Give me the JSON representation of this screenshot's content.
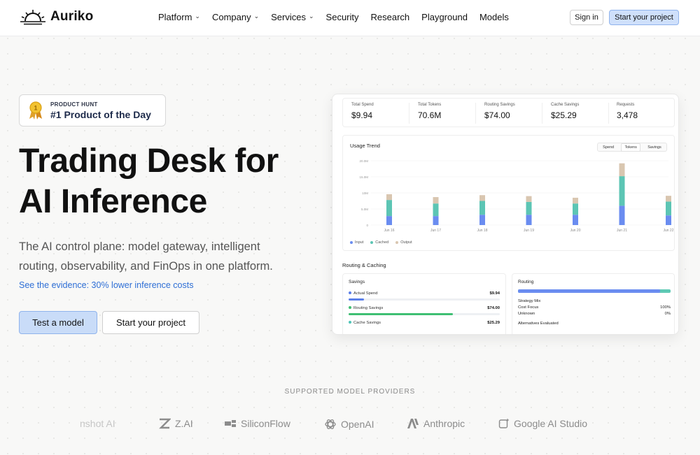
{
  "nav": {
    "brand": "Auriko",
    "links": [
      {
        "label": "Platform",
        "dropdown": true
      },
      {
        "label": "Company",
        "dropdown": true
      },
      {
        "label": "Services",
        "dropdown": true
      },
      {
        "label": "Security",
        "dropdown": false
      },
      {
        "label": "Research",
        "dropdown": false
      },
      {
        "label": "Playground",
        "dropdown": false
      },
      {
        "label": "Models",
        "dropdown": false
      }
    ],
    "sign_in": "Sign in",
    "cta": "Start your project"
  },
  "hero": {
    "badge_small": "PRODUCT HUNT",
    "badge_big": "#1 Product of the Day",
    "title_line1": "Trading Desk for",
    "title_line2": "AI Inference",
    "subtitle": "The AI control plane: model gateway, intelligent routing, observability, and FinOps in one platform.",
    "evidence": "See the evidence: 30% lower inference costs",
    "btn_primary": "Test a model",
    "btn_secondary": "Start your project"
  },
  "dashboard": {
    "stats": [
      {
        "label": "Total Spend",
        "value": "$9.94"
      },
      {
        "label": "Total Tokens",
        "value": "70.6M"
      },
      {
        "label": "Routing Savings",
        "value": "$74.00"
      },
      {
        "label": "Cache Savings",
        "value": "$25.29"
      },
      {
        "label": "Requests",
        "value": "3,478"
      }
    ],
    "usage": {
      "title": "Usage Trend",
      "tabs": [
        "Spend",
        "Tokens",
        "Savings"
      ],
      "active_tab": "Tokens"
    },
    "routing_caching_title": "Routing & Caching",
    "savings": {
      "title": "Savings",
      "rows": [
        {
          "label": "Actual Spend",
          "value": "$9.94",
          "fill": 0.1,
          "color": "#5b7fe9"
        },
        {
          "label": "Routing Savings",
          "value": "$74.00",
          "fill": 0.69,
          "color": "#3fbf73"
        },
        {
          "label": "Cache Savings",
          "value": "$25.29",
          "fill": 0.24,
          "color": "#4fc4b8"
        }
      ]
    },
    "routing": {
      "title": "Routing",
      "strategy_mix": "Strategy Mix",
      "rows": [
        {
          "label": "Cost Focus",
          "value": "100%"
        },
        {
          "label": "Unknown",
          "value": "0%"
        }
      ],
      "alternatives": "Alternatives Evaluated",
      "bar_fill": 0.93
    }
  },
  "chart_data": {
    "type": "bar",
    "stacked": true,
    "title": "Usage Trend",
    "categories": [
      "Jun 16",
      "Jun 17",
      "Jun 18",
      "Jun 19",
      "Jun 20",
      "Jun 21",
      "Jun 22"
    ],
    "y_tick_labels": [
      "0",
      "5.0M",
      "10M",
      "15.0M",
      "20.0M"
    ],
    "ylim": [
      0,
      20000000
    ],
    "series": [
      {
        "name": "Input",
        "color": "#6a8cf0",
        "values": [
          2800000,
          2800000,
          3200000,
          3200000,
          3200000,
          6000000,
          3000000
        ]
      },
      {
        "name": "Cached",
        "color": "#5cc5b4",
        "values": [
          5000000,
          3900000,
          4300000,
          4000000,
          3500000,
          9200000,
          4300000
        ]
      },
      {
        "name": "Output",
        "color": "#d9c6b0",
        "values": [
          1800000,
          2000000,
          1800000,
          1800000,
          1800000,
          4000000,
          1800000
        ]
      }
    ],
    "grid": true,
    "legend": "bottom-left"
  },
  "providers": {
    "title": "SUPPORTED MODEL PROVIDERS",
    "items": [
      {
        "name": "nshot AI",
        "icon": "none"
      },
      {
        "name": "Z.AI",
        "icon": "zai-logo-icon"
      },
      {
        "name": "SiliconFlow",
        "icon": "siliconflow-logo-icon"
      },
      {
        "name": "OpenAI",
        "icon": "openai-logo-icon"
      },
      {
        "name": "Anthropic",
        "icon": "anthropic-logo-icon"
      },
      {
        "name": "Google AI Studio",
        "icon": "google-ai-studio-logo-icon"
      }
    ]
  }
}
